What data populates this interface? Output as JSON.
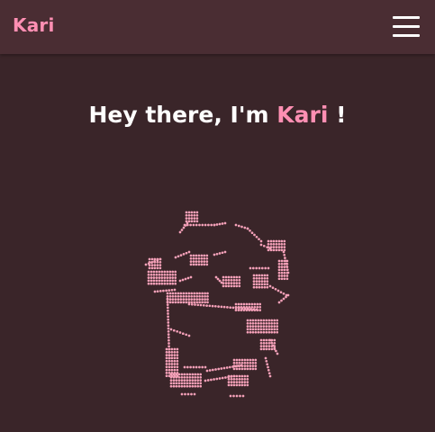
{
  "navbar": {
    "brand": "Kari",
    "menu_icon": "hamburger-menu-icon"
  },
  "hero": {
    "greeting_prefix": "Hey there, I'm ",
    "name": "Kari",
    "greeting_suffix": " !"
  },
  "art": {
    "icon": "braille-ascii-portrait"
  },
  "colors": {
    "page_bg": "#3a2529",
    "navbar_bg": "#4a2d33",
    "accent_pink": "#ff8fb3",
    "art_pink": "#f4a0b8",
    "text_white": "#ffffff"
  }
}
